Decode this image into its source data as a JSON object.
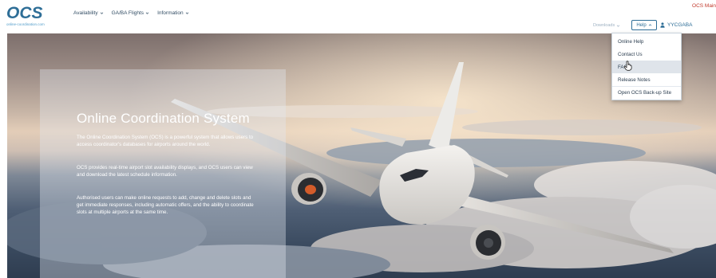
{
  "header": {
    "logo_text": "OCS",
    "logo_subtitle": "online-coordination.com",
    "nav": [
      {
        "label": "Availability",
        "icon": "chevron-down-icon"
      },
      {
        "label": "GA/BA Flights",
        "icon": "chevron-down-icon"
      },
      {
        "label": "Information",
        "icon": "chevron-down-icon"
      }
    ],
    "org_label": "OCS Main",
    "downloads_label": "Downloads",
    "help_label": "Help",
    "user_label": "YYCGABA"
  },
  "hero": {
    "title": "Online Coordination System",
    "paragraphs": [
      "The Online Coordination System (OCS) is a powerful system that allows users to access coordinator's databases for airports around the world.",
      "OCS provides real-time airport slot availability displays, and OCS users can view and download the latest schedule information.",
      "Authorised users can make online requests to add, change and delete slots and get immediate responses, including automatic offers, and the ability to coordinate slots at multiple airports at the same time."
    ]
  },
  "help_menu": {
    "items": [
      "Online Help",
      "Contact Us",
      "FAQ",
      "Release Notes",
      "Open OCS Back-up Site"
    ],
    "hovered": "FAQ"
  },
  "colors": {
    "brand_blue": "#2e6e97",
    "org_red": "#c0392b",
    "nav_text": "#334e65"
  }
}
